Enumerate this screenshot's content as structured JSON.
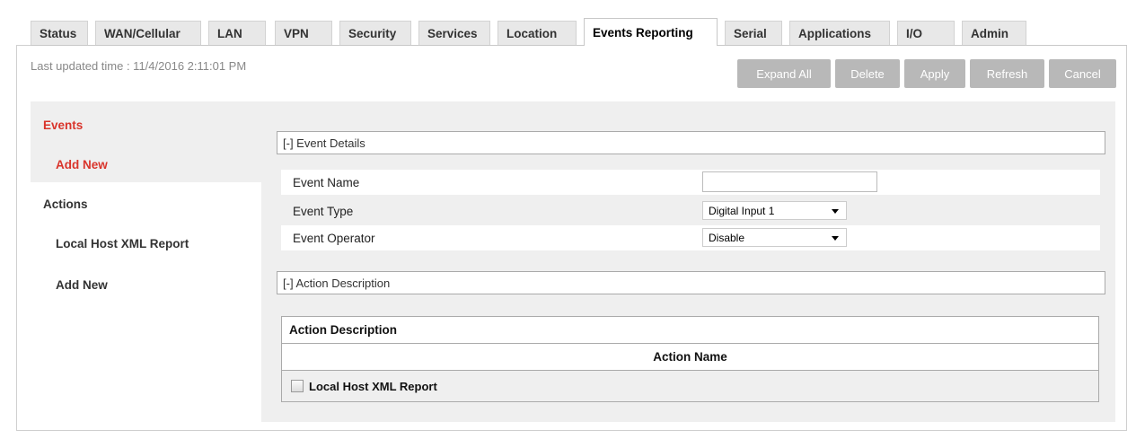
{
  "tabs": [
    {
      "label": "Status"
    },
    {
      "label": "WAN/Cellular"
    },
    {
      "label": "LAN"
    },
    {
      "label": "VPN"
    },
    {
      "label": "Security"
    },
    {
      "label": "Services"
    },
    {
      "label": "Location"
    },
    {
      "label": "Events Reporting",
      "active": true
    },
    {
      "label": "Serial"
    },
    {
      "label": "Applications"
    },
    {
      "label": "I/O"
    },
    {
      "label": "Admin"
    }
  ],
  "status": {
    "last_updated": "Last updated time : 11/4/2016 2:11:01 PM"
  },
  "toolbar": {
    "expand_all": "Expand All",
    "delete": "Delete",
    "apply": "Apply",
    "refresh": "Refresh",
    "cancel": "Cancel"
  },
  "sidebar": {
    "events": "Events",
    "events_add_new": "Add New",
    "actions": "Actions",
    "local_host_xml_report": "Local Host XML Report",
    "actions_add_new": "Add New"
  },
  "event_details": {
    "header": "[-] Event Details",
    "fields": {
      "event_name": {
        "label": "Event Name",
        "value": ""
      },
      "event_type": {
        "label": "Event Type",
        "value": "Digital Input 1"
      },
      "event_operator": {
        "label": "Event Operator",
        "value": "Disable"
      }
    }
  },
  "action_description": {
    "header": "[-] Action Description",
    "table": {
      "title": "Action Description",
      "column": "Action Name",
      "rows": [
        {
          "label": "Local Host XML Report",
          "checked": false
        }
      ]
    }
  },
  "colors": {
    "accent_red": "#d9342b",
    "button_gray": "#b8b8b8",
    "content_bg": "#efefef"
  }
}
